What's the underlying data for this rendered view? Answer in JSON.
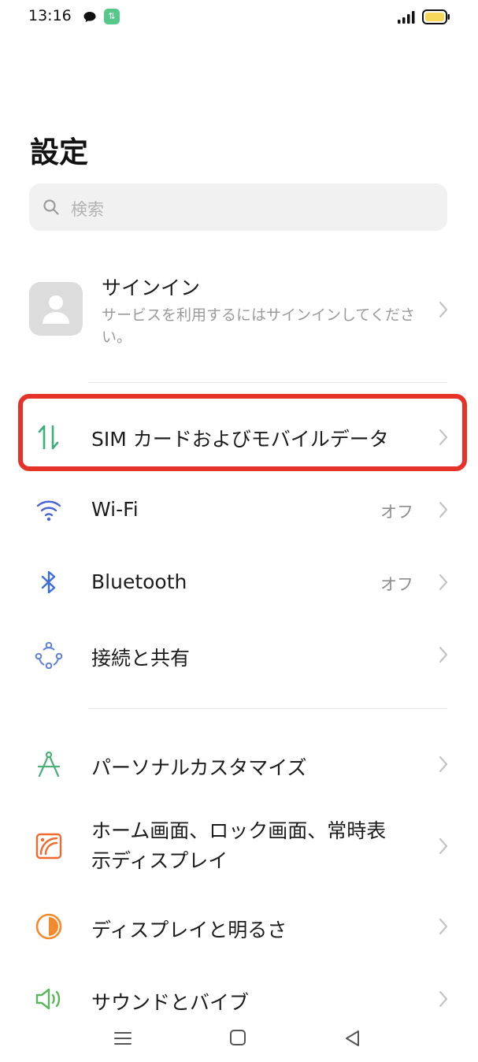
{
  "status_bar": {
    "time": "13:16",
    "data_badge": "⇅",
    "icons": [
      "chat-bubble-icon",
      "data-transfer-icon",
      "signal-icon",
      "battery-icon"
    ]
  },
  "header": {
    "title": "設定"
  },
  "search": {
    "placeholder": "検索"
  },
  "account": {
    "title": "サインイン",
    "subtitle": "サービスを利用するにはサインインしてください。"
  },
  "settings": [
    {
      "label": "SIM カードおよびモバイルデータ",
      "value": "",
      "icon": "sim-data-icon",
      "highlighted": true
    },
    {
      "label": "Wi-Fi",
      "value": "オフ",
      "icon": "wifi-icon"
    },
    {
      "label": "Bluetooth",
      "value": "オフ",
      "icon": "bluetooth-icon"
    },
    {
      "label": "接続と共有",
      "value": "",
      "icon": "connection-share-icon"
    },
    {
      "label": "パーソナルカスタマイズ",
      "value": "",
      "icon": "compass-icon"
    },
    {
      "label": "ホーム画面、ロック画面、常時表示ディスプレイ",
      "label_line1": "ホーム画面、ロック画面、常時表",
      "label_line2": "示ディスプレイ",
      "value": "",
      "icon": "wallpaper-icon"
    },
    {
      "label": "ディスプレイと明るさ",
      "value": "",
      "icon": "brightness-icon"
    },
    {
      "label": "サウンドとバイブ",
      "value": "",
      "icon": "speaker-icon"
    }
  ],
  "nav_bar": {
    "icons": [
      "menu-icon",
      "home-icon",
      "back-icon"
    ]
  },
  "colors": {
    "highlight": "#e5332a",
    "sim_icon": "#3dae7b",
    "wifi_icon": "#4a63d6",
    "bluetooth_icon": "#3c6de0",
    "personalize_icon": "#4caf78",
    "wallpaper_icon": "#f06a2c",
    "brightness_icon": "#f28a2e",
    "sound_icon": "#58b65d"
  }
}
